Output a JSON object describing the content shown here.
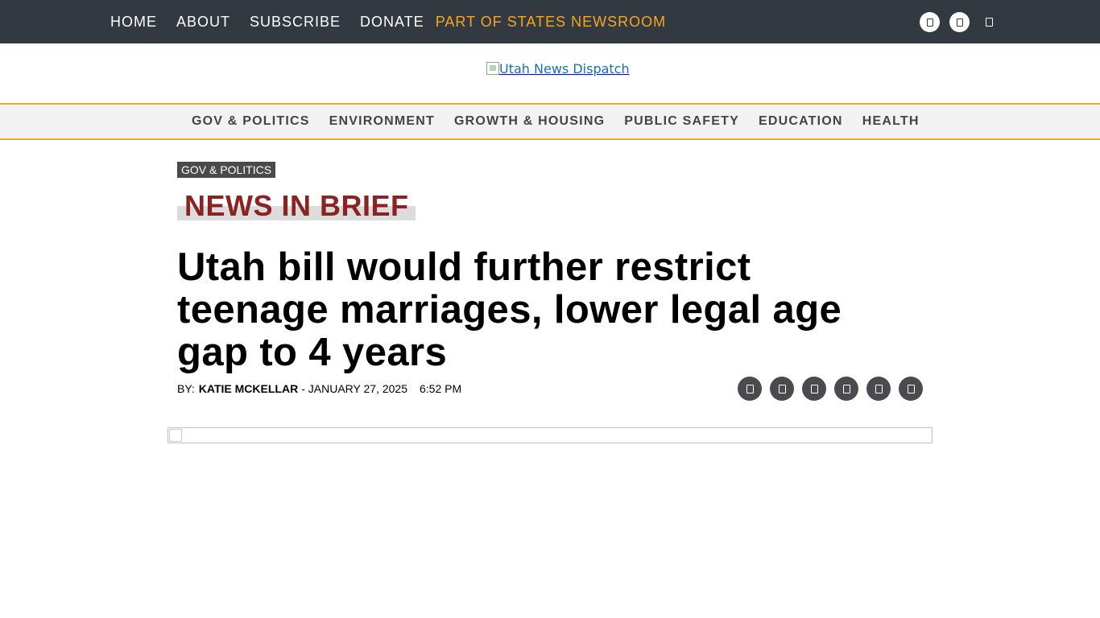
{
  "topnav": {
    "items": [
      "HOME",
      "ABOUT",
      "SUBSCRIBE",
      "DONATE"
    ],
    "states_link": "PART OF STATES NEWSROOM"
  },
  "social_icons": [
    "facebook-icon",
    "x-twitter-icon"
  ],
  "logo": {
    "alt": "Utah News Dispatch"
  },
  "sections": [
    "GOV & POLITICS",
    "ENVIRONMENT",
    "GROWTH & HOUSING",
    "PUBLIC SAFETY",
    "EDUCATION",
    "HEALTH"
  ],
  "article": {
    "category": "GOV & POLITICS",
    "kicker": "NEWS IN BRIEF",
    "headline": "Utah bill would further restrict teenage marriages, lower legal age gap to 4 years",
    "by_label": "BY:",
    "author": "KATIE MCKELLAR",
    "date": "- JANUARY 27, 2025",
    "time": "6:52 PM"
  },
  "share_icons": [
    "facebook-share-icon",
    "x-share-icon",
    "email-share-icon",
    "linkedin-share-icon",
    "print-share-icon",
    "republish-share-icon"
  ],
  "colors": {
    "topbar": "#333940",
    "accent": "#f0a92f",
    "kicker": "#8b2323",
    "share": "#4a4a4f"
  }
}
